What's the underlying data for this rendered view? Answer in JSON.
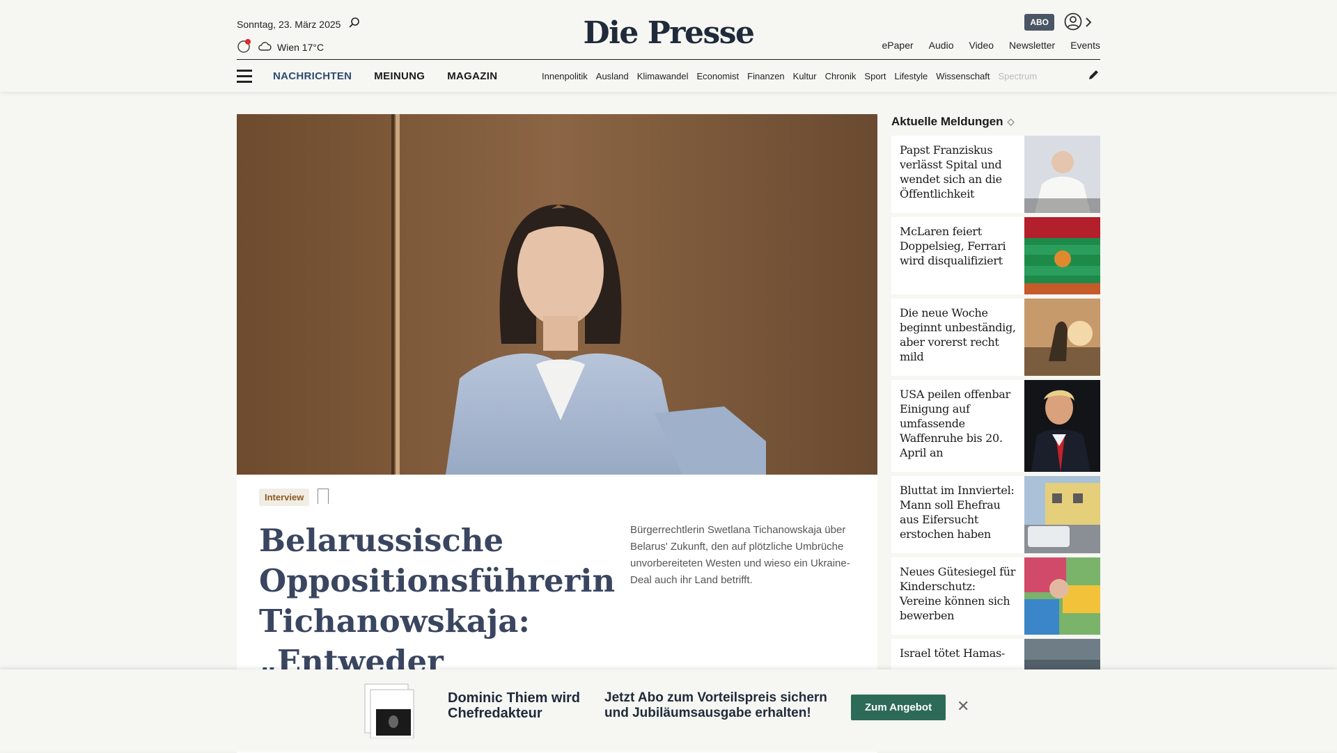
{
  "header": {
    "date": "Sonntag, 23. März 2025",
    "weather": "Wien 17°C",
    "logo": "Die Presse",
    "abo": "ABO",
    "top_links": [
      "ePaper",
      "Audio",
      "Video",
      "Newsletter",
      "Events"
    ]
  },
  "nav": {
    "main": [
      "NACHRICHTEN",
      "MEINUNG",
      "MAGAZIN"
    ],
    "sub": [
      "Innenpolitik",
      "Ausland",
      "Klimawandel",
      "Economist",
      "Finanzen",
      "Kultur",
      "Chronik",
      "Sport",
      "Lifestyle",
      "Wissenschaft",
      "Spectrum"
    ]
  },
  "article": {
    "tag": "Interview",
    "headline": "Belarussische Oppositionsführerin Tichanowskaja: „Entweder Russland",
    "teaser": "Bürgerrechtlerin Swetlana Tichanowskaja über Belarus' Zukunft, den auf plötzliche Umbrüche unvorbereiteten Westen und wieso ein Ukraine-Deal auch ihr Land betrifft."
  },
  "sidebar": {
    "title": "Aktuelle Meldungen",
    "items": [
      {
        "title": "Papst Franziskus verlässt Spital und wendet sich an die Öffentlichkeit"
      },
      {
        "title": "McLaren feiert Doppelsieg, Ferrari wird disqualifiziert"
      },
      {
        "title": "Die neue Woche beginnt unbeständig, aber vorerst recht mild"
      },
      {
        "title": "USA peilen offenbar Einigung auf umfassende Waffenruhe bis 20. April an"
      },
      {
        "title": "Bluttat im Innviertel: Mann soll Ehefrau aus Eifersucht erstochen haben"
      },
      {
        "title": "Neues Gütesiegel für Kinderschutz: Vereine können sich bewerben"
      },
      {
        "title": "Israel tötet Hamas-"
      }
    ]
  },
  "banner": {
    "line1": "Dominic Thiem wird Chefredakteur",
    "line2": "Jetzt Abo zum Vorteilspreis sichern und Jubiläumsausgabe erhalten!",
    "cta": "Zum Angebot"
  }
}
